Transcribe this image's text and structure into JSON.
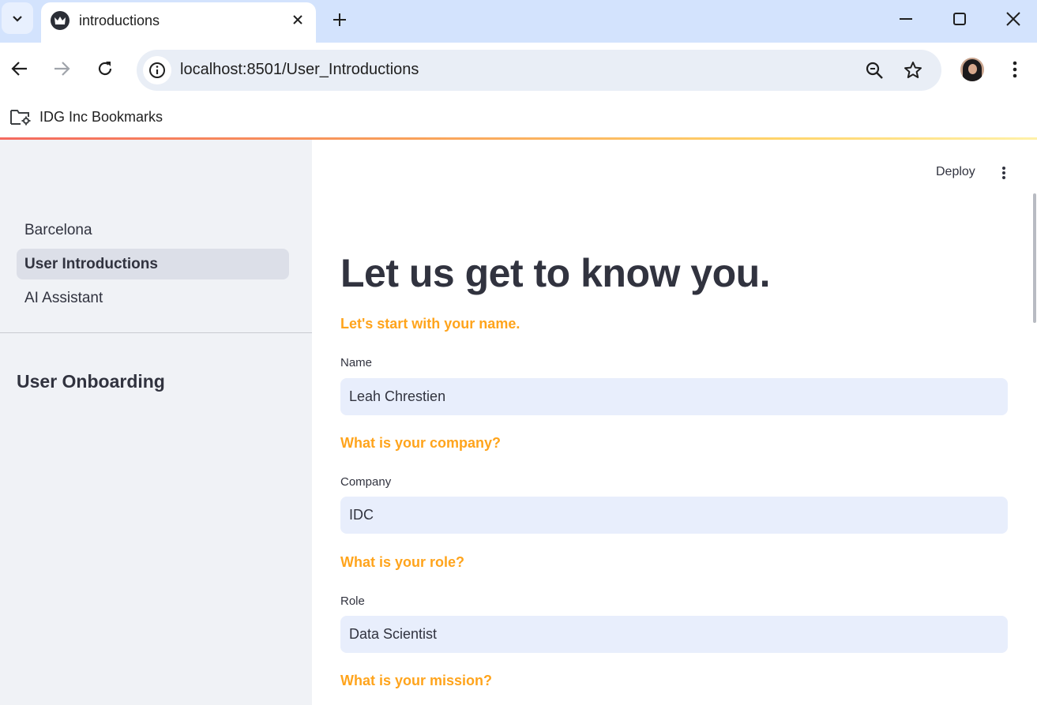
{
  "browser": {
    "tab_title": "introductions",
    "url": "localhost:8501/User_Introductions",
    "bookmark_folder": "IDG Inc Bookmarks"
  },
  "app": {
    "deploy_label": "Deploy",
    "sidebar": {
      "items": [
        {
          "label": "Barcelona",
          "active": false
        },
        {
          "label": "User Introductions",
          "active": true
        },
        {
          "label": "AI Assistant",
          "active": false
        }
      ],
      "section_heading": "User Onboarding"
    },
    "main": {
      "title": "Let us get to know you.",
      "sections": [
        {
          "subheader": "Let's start with your name.",
          "label": "Name",
          "value": "Leah Chrestien"
        },
        {
          "subheader": "What is your company?",
          "label": "Company",
          "value": "IDC"
        },
        {
          "subheader": "What is your role?",
          "label": "Role",
          "value": "Data Scientist"
        },
        {
          "subheader": "What is your mission?"
        }
      ]
    }
  },
  "colors": {
    "accent_subheader": "#ffa41c",
    "sidebar_bg": "#f0f2f6",
    "input_bg": "#e8eefc",
    "text": "#31333f",
    "tabstrip_bg": "#d3e3fd"
  },
  "icons": [
    "tab-search-icon",
    "streamlit-crown-icon",
    "close-icon",
    "plus-icon",
    "minimize-icon",
    "maximize-icon",
    "window-close-icon",
    "back-icon",
    "forward-icon",
    "reload-icon",
    "info-icon",
    "zoom-icon",
    "star-icon",
    "more-vert-icon",
    "folder-settings-icon",
    "kebab-icon"
  ]
}
